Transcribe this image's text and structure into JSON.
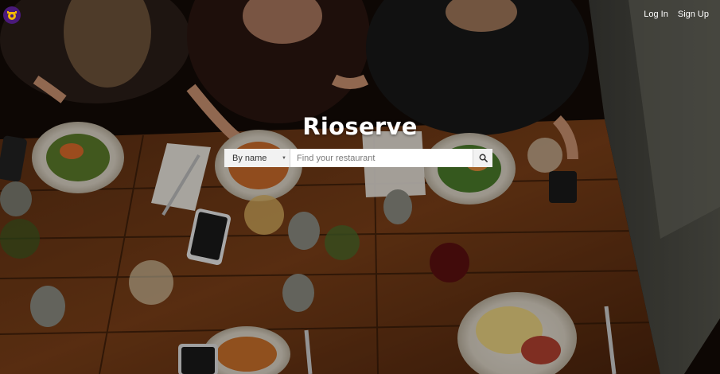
{
  "header": {
    "logo_icon": "restaurant-logo-icon",
    "login_label": "Log In",
    "signup_label": "Sign Up"
  },
  "hero": {
    "brand_title": "Rioserve",
    "background_description_icon": "restaurant-table-photo"
  },
  "search": {
    "filter_selected": "By name",
    "input_placeholder": "Find your restaurant",
    "input_value": "",
    "search_icon": "search-icon"
  },
  "colors": {
    "logo_bg": "#4a1a7a",
    "logo_accent": "#f2b705",
    "text_white": "#ffffff",
    "search_bg": "#ffffff",
    "search_addon_bg": "#f2f2f2"
  }
}
